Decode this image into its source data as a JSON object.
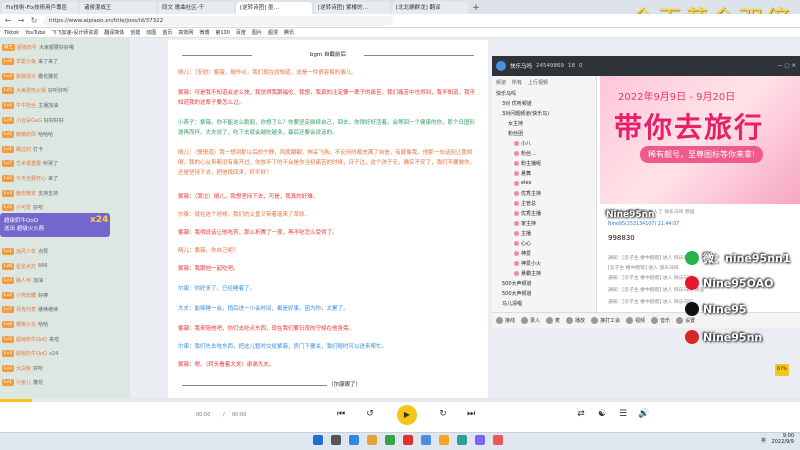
{
  "browser": {
    "tabs": [
      "Fix技術-Fix技術用戶專區",
      "诸侯混成王",
      "同文 歌曲社区-千",
      "[逆转诗团] 墨…",
      "[逆转诗团] 紫楼的…",
      "[北北确群龙] 翻译",
      "+"
    ],
    "url": "https://www.aipiaoo.xn/title/joss/id/37322",
    "bookmarks": [
      "Tiktok",
      "YouTube",
      "飞飞加速-设计师资源",
      "翻译简体",
      "创建",
      "动图",
      "首页",
      "高效网",
      "微博",
      "第100",
      "百度",
      "图片",
      "超漫",
      "腾讯"
    ]
  },
  "overlay": {
    "title": "今天黄金双倍"
  },
  "left_chat": {
    "rows": [
      {
        "badge": "骑士",
        "name": "超级奶牛",
        "text": "大家都要好好哦"
      },
      {
        "badge": "Lv8",
        "name": "羊驼小兔",
        "text": "来了来了"
      },
      {
        "badge": "Lv3",
        "name": "默默观众",
        "text": "撒花撒花"
      },
      {
        "badge": "Lv5",
        "name": "大美爱吃火锅",
        "text": "好听好听"
      },
      {
        "badge": "Lv2",
        "name": "牛牛粉丝",
        "text": "主播加油"
      },
      {
        "badge": "Lv4",
        "name": "小云朵GaG",
        "text": "好好好好"
      },
      {
        "badge": "Lv6",
        "name": "暖暖的风",
        "text": "哈哈哈"
      },
      {
        "badge": "Lv1",
        "name": "路过的",
        "text": "打卡"
      },
      {
        "badge": "Lv7",
        "name": "艺术很重要",
        "text": "听哭了"
      },
      {
        "badge": "Lv2",
        "name": "今天也要开心",
        "text": "来了"
      },
      {
        "badge": "Lv3",
        "name": "晚安晚安",
        "text": "支持支持"
      },
      {
        "badge": "Lv5",
        "name": "小可爱",
        "text": "好听"
      },
      {
        "badge": "Lv4",
        "name": "三岁宝宝",
        "text": "哇哦"
      },
      {
        "badge": "Lv2",
        "name": "奶茶不加糖",
        "text": "好可爱"
      },
      {
        "badge": "Lv1",
        "name": "追风少年",
        "text": "点赞"
      },
      {
        "badge": "Lv6",
        "name": "星星点灯",
        "text": "666"
      },
      {
        "badge": "Lv3",
        "name": "路人甲",
        "text": "加油"
      },
      {
        "badge": "Lv2",
        "name": "小熊软糖",
        "text": "好棒"
      },
      {
        "badge": "Lv7",
        "name": "月亮代表",
        "text": "继续继续"
      },
      {
        "badge": "Lv4",
        "name": "樱桃小丸",
        "text": "哈哈"
      },
      {
        "badge": "Lv5",
        "name": "超级奶牛QoQ",
        "text": "来啦"
      },
      {
        "badge": "Lv3",
        "name": "超级奶牛QoQ",
        "text": "x24"
      },
      {
        "badge": "Lv2",
        "name": "大白兔",
        "text": "好听"
      },
      {
        "badge": "Lv1",
        "name": "小鱼儿",
        "text": "撒花"
      }
    ],
    "gift": {
      "name": "超级奶牛QoQ",
      "text": "送出 超级火火箭",
      "count": "x24"
    }
  },
  "document": {
    "heading": "bgm 自截前后",
    "paragraphs": [
      {
        "speaker": "晴儿",
        "color": "orange",
        "text": "晴儿：（安慰）紫薇，振作点，我们现在就知道，这是一件很容易的事儿。"
      },
      {
        "speaker": "紫薇",
        "color": "red",
        "text": "紫薇：可是我不知道会这么快，我觉得我跟福伦、我想，我真的注定要一辈子的痛苦、我们痛苦中也得到，我不知道，我不知道我的这辈子要怎么过。"
      },
      {
        "speaker": "小燕子",
        "color": "green",
        "text": "小燕子：紫薇，你不能这么脆弱，你想了么？你要坚定继续自己，回去，你得好好活着。会等回一个健康的你，那个日图形遂再而杯。大夫说了，吃下去就会越吃越多，最后还要会说话的。"
      },
      {
        "speaker": "晴儿",
        "color": "orange",
        "text": "晴儿：（慢慢道）我一想到那以后的宁静，风度翩翩，神采飞扬，不论何时都充满了自信，有颇像我。他那一句话就让我倾倒，我的心从来都没有离开过，你放不下的不会是你当初痛苦的时候，日子过，这个孩子无，确实不安了，我们不要做伤，还是坚持下去，把他找回来，好不好？"
      },
      {
        "speaker": "紫薇",
        "color": "red",
        "text": "紫薇：（哭泣）晴儿，我想坚持下去，可是，我真的好难。"
      },
      {
        "speaker": "尔泰",
        "color": "orange",
        "text": "尔泰：就在这个时候，我们的父皇又带着瑶来了草原。"
      },
      {
        "speaker": "紫薇",
        "color": "red",
        "text": "紫薇：我得说话让他吃药，那么折腾了一夜，再不吃怎么受得了。"
      },
      {
        "speaker": "晴儿",
        "color": "orange",
        "text": "晴儿：紫薇，你自己呢？"
      },
      {
        "speaker": "紫薇",
        "color": "red",
        "text": "紫薇：我跟他一起吃吧。"
      },
      {
        "speaker": "尔康",
        "color": "blue",
        "text": "尔康：你好多了，已经睡着了。"
      },
      {
        "speaker": "大夫",
        "color": "blue",
        "text": "大夫：能够睡一会，稍后进一小会时间，都是好事。因为你，太累了。"
      },
      {
        "speaker": "紫薇",
        "color": "red",
        "text": "紫薇：我来陪他吧，你们去吃点东西，现在我们要日夜的守候在他身旁。"
      },
      {
        "speaker": "尔康",
        "color": "blue",
        "text": "尔康：我们先去吃东西，把这儿暂时交给紫薇，房门下要关，我们随时可以进来帮忙。"
      },
      {
        "speaker": "紫薇",
        "color": "red",
        "text": "紫薇：嗯。（转头看着大夫）谢谢大夫。"
      }
    ],
    "footer_note": "（尔康眼了）"
  },
  "player": {
    "current_time": "00:00",
    "total_time": "00:00",
    "progress_pct": 4,
    "volume_pct": "67%"
  },
  "live_app": {
    "room_name": "快乐马吗",
    "room_id": "24549869",
    "viewers": "18",
    "coins": "0",
    "tabs": [
      "频道",
      "所有",
      "上行视频"
    ],
    "tree": [
      {
        "label": "快乐马吗",
        "level": 0
      },
      {
        "label": "3对 优听频道",
        "level": 1
      },
      {
        "label": "3对问题频道(快乐马)",
        "level": 1
      },
      {
        "label": "女主持",
        "level": 2
      },
      {
        "label": "粉丝团",
        "level": 2
      },
      {
        "label": "小八",
        "level": 3
      },
      {
        "label": "粉丝...",
        "level": 3
      },
      {
        "label": "粉主播呢",
        "level": 3
      },
      {
        "label": "悬舞",
        "level": 3
      },
      {
        "label": "elex",
        "level": 3
      },
      {
        "label": "优秀主持",
        "level": 3
      },
      {
        "label": "主管总",
        "level": 3
      },
      {
        "label": "优秀主播",
        "level": 3
      },
      {
        "label": "家主持",
        "level": 3
      },
      {
        "label": "主播",
        "level": 3
      },
      {
        "label": "心心",
        "level": 3
      },
      {
        "label": "神爱",
        "level": 3
      },
      {
        "label": "神爱小火",
        "level": 3
      },
      {
        "label": "悬霸主持",
        "level": 3
      },
      {
        "label": "500大声频道",
        "level": 1
      },
      {
        "label": "500大声频道",
        "level": 1
      },
      {
        "label": "马儿清唱",
        "level": 1
      }
    ],
    "banner": {
      "date": "2022年9月9日 - 9月20日",
      "headline": "带你去旅行",
      "sub": "稀有靓号，至尊图标等你来拿!"
    },
    "chat": [
      {
        "cls": "grey",
        "text": "[云子生 楼中刚帮] 进入了 快乐马吗 频道"
      },
      {
        "cls": "blu",
        "text": "Nine95(253134107)  21:44:07"
      },
      {
        "cls": "big",
        "text": "998830"
      },
      {
        "cls": "grey",
        "text": "通知：[云子生 楼中刚帮] 进入 快乐马吗"
      },
      {
        "cls": "grey",
        "text": "[云子生 楼中刚帮] 进入 快乐马吗"
      },
      {
        "cls": "grey",
        "text": "通知：[云子生 楼中刚帮] 进入 快乐马吗"
      },
      {
        "cls": "grey",
        "text": "通知：[云子生 楼中刚帮] 进入 快乐马吗 频道"
      },
      {
        "cls": "grey",
        "text": "通知：[云子生 楼中刚帮] 进入 快乐马吗"
      }
    ],
    "bottom_buttons": [
      "接线",
      "录入",
      "麦",
      "播放",
      "接打工会",
      "视频",
      "音乐",
      "设置"
    ]
  },
  "socials": [
    {
      "icon": "wechat-icon",
      "label": "微：nine95nn1",
      "color": "#27b24a"
    },
    {
      "icon": "weibo-icon",
      "label": "Nine95OAO",
      "color": "#e6162d"
    },
    {
      "icon": "tiktok-icon",
      "label": "Nine95",
      "color": "#111111"
    },
    {
      "icon": "netease-music-icon",
      "label": "Nine95nn",
      "color": "#d9262a"
    }
  ],
  "floating": {
    "nine95": "Nine95nn"
  },
  "taskbar": {
    "time": "9:00",
    "date": "2022/9/9",
    "tray": "英"
  }
}
